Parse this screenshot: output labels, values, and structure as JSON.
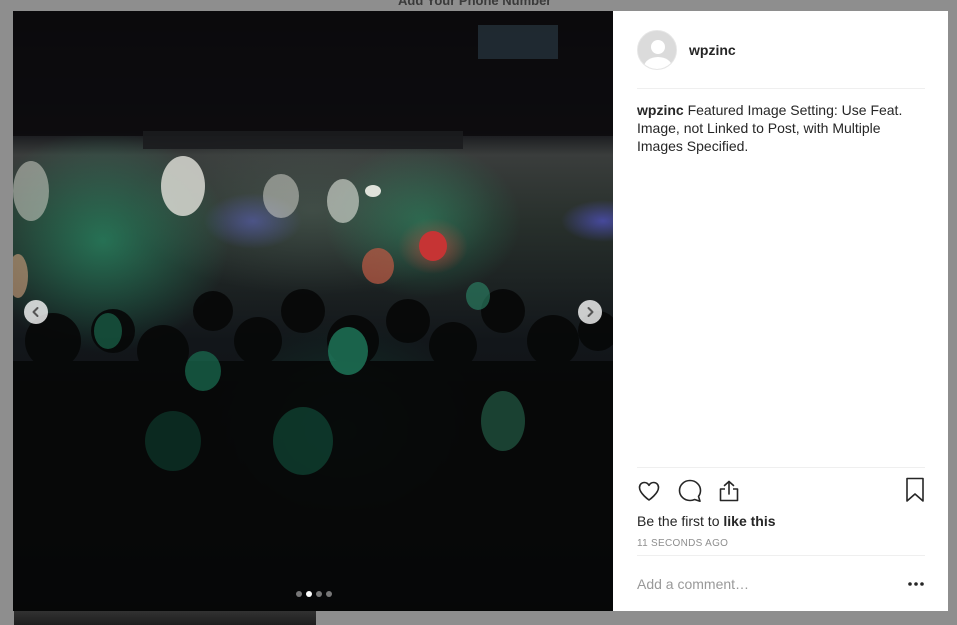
{
  "background": {
    "title": "Add Your Phone Number"
  },
  "post": {
    "username": "wpzinc",
    "caption_user": "wpzinc",
    "caption_text": "Featured Image Setting: Use Feat. Image, not Linked to Post, with Multiple Images Specified.",
    "likes_prefix": "Be the first to ",
    "likes_action": "like this",
    "timestamp": "11 SECONDS AGO",
    "comment_placeholder": "Add a comment…"
  },
  "carousel": {
    "slide_count": 4,
    "active_index": 1
  },
  "icons": {
    "prev": "chevron-left-icon",
    "next": "chevron-right-icon",
    "like": "heart-icon",
    "comment": "comment-bubble-icon",
    "share": "share-icon",
    "save": "bookmark-icon",
    "more": "more-options-icon",
    "avatar": "default-avatar-icon"
  },
  "colors": {
    "overlay": "#8e8e8e",
    "text": "#262626",
    "muted": "#8e8e8e",
    "border": "#efefef"
  }
}
